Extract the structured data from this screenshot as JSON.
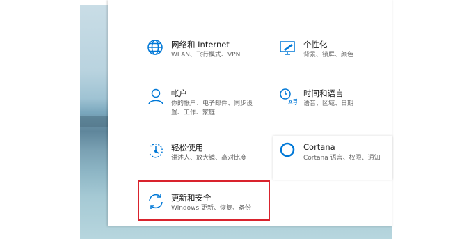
{
  "cutoff_text": {
    "left": "·· ·· ·· ··",
    "right": "·· ·· ·· ··"
  },
  "tiles": [
    {
      "title": "网络和 Internet",
      "desc": "WLAN、飞行模式、VPN",
      "icon": "globe-icon"
    },
    {
      "title": "个性化",
      "desc": "背景、锁屏、颜色",
      "icon": "personalization-icon"
    },
    {
      "title": "帐户",
      "desc": "你的帐户、电子邮件、同步设置、工作、家庭",
      "icon": "person-icon"
    },
    {
      "title": "时间和语言",
      "desc": "语音、区域、日期",
      "icon": "time-language-icon"
    },
    {
      "title": "轻松使用",
      "desc": "讲述人、放大镜、高对比度",
      "icon": "ease-of-access-icon"
    },
    {
      "title": "Cortana",
      "desc": "Cortana 语言、权限、通知",
      "icon": "cortana-icon"
    },
    {
      "title": "更新和安全",
      "desc": "Windows 更新、恢复、备份",
      "icon": "sync-icon"
    }
  ],
  "colors": {
    "accent": "#0078d7",
    "highlight": "#d9232d"
  }
}
